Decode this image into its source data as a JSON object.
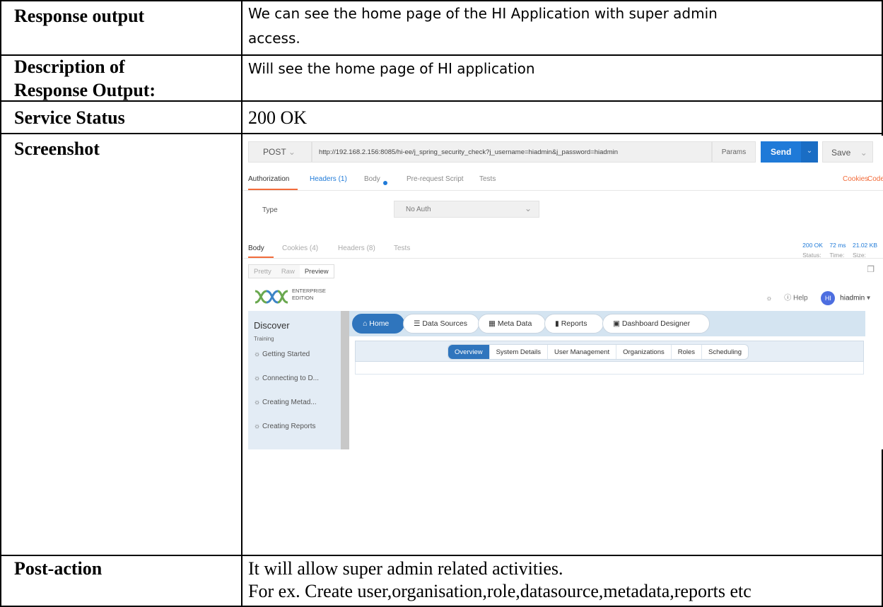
{
  "rows": [
    {
      "label": "Response output",
      "value_lines": [
        "We can see the home page of the HI Application with super admin",
        "access."
      ]
    },
    {
      "label_lines": [
        "Description of",
        "Response Output:"
      ],
      "value": "Will see the home page of HI application"
    },
    {
      "label": "Service Status",
      "value": "200 OK"
    },
    {
      "label": "Screenshot"
    },
    {
      "label": "Post-action",
      "value_lines": [
        "It will allow super admin related activities.",
        "For ex. Create user,organisation,role,datasource,metadata,reports etc"
      ]
    }
  ],
  "screenshot": {
    "method": "POST",
    "url": "http://192.168.2.156:8085/hi-ee/j_spring_security_check?j_username=hiadmin&j_password=hiadmin",
    "params": "Params",
    "send": "Send",
    "save": "Save",
    "request_tabs": [
      "Authorization",
      "Headers (1)",
      "Body",
      "Pre-request Script",
      "Tests"
    ],
    "cookies_link": "Cookies",
    "code_link": "Code",
    "auth_type_label": "Type",
    "auth_type_value": "No Auth",
    "response_tabs": [
      "Body",
      "Cookies (4)",
      "Headers (8)",
      "Tests"
    ],
    "status_label": "Status:",
    "status_value": "200 OK",
    "time_label": "Time:",
    "time_value": "72 ms",
    "size_label": "Size:",
    "size_value": "21.02 KB",
    "view_modes": [
      "Pretty",
      "Raw",
      "Preview"
    ],
    "app": {
      "logo_line1": "ENTERPRISE",
      "logo_line2": "EDITION",
      "help": "Help",
      "avatar": "HI",
      "user": "hiadmin",
      "sidebar_title": "Discover",
      "sidebar_sub": "Training",
      "sidebar_items": [
        "Getting Started",
        "Connecting to D...",
        "Creating Metad...",
        "Creating Reports"
      ],
      "nav": [
        "Home",
        "Data Sources",
        "Meta Data",
        "Reports",
        "Dashboard Designer"
      ],
      "subtabs": [
        "Overview",
        "System Details",
        "User Management",
        "Organizations",
        "Roles",
        "Scheduling"
      ]
    }
  },
  "colors": {
    "accent_blue": "#1f7ad8",
    "tab_orange": "#f26b3a",
    "app_blue": "#2f75bd"
  }
}
